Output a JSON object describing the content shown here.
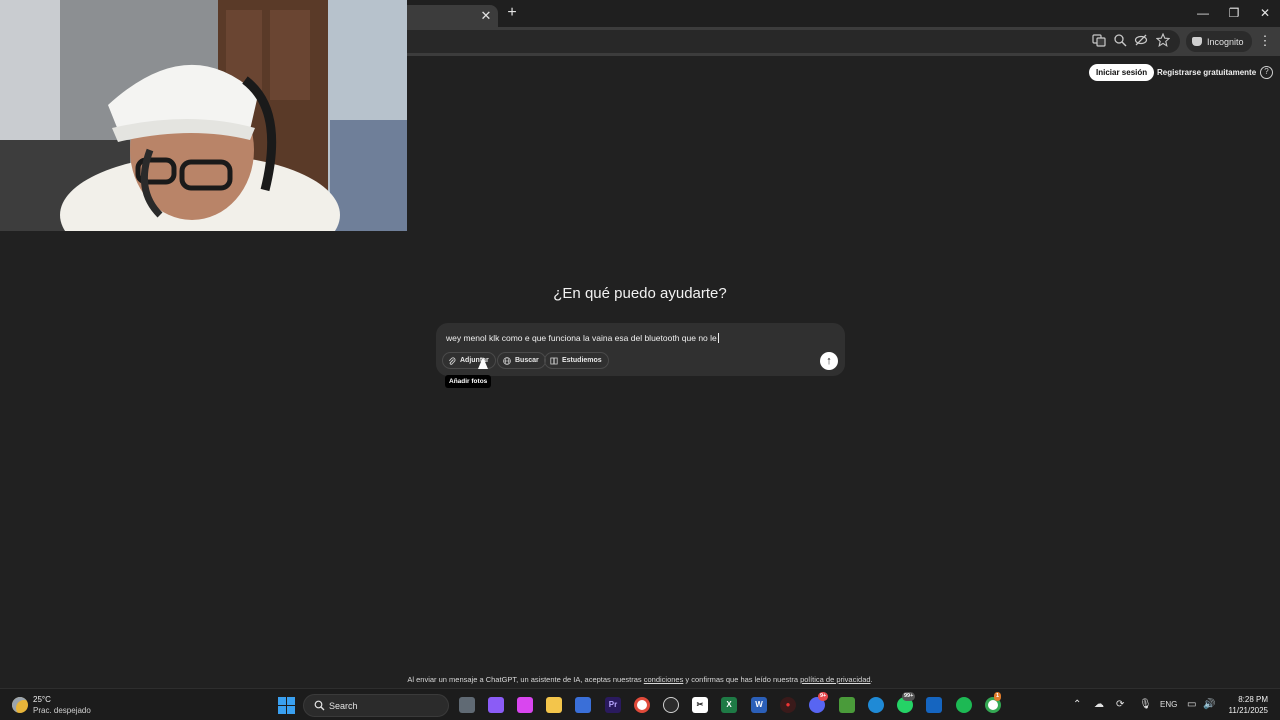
{
  "browser": {
    "tab_close": "✕",
    "new_tab": "+",
    "incognito_label": "Incognito",
    "window_controls": {
      "minimize": "—",
      "restore": "❐",
      "close": "✕"
    }
  },
  "header": {
    "login_label": "Iniciar sesión",
    "signup_label": "Registrarse gratuitamente",
    "help_glyph": "?"
  },
  "main": {
    "headline": "¿En qué puedo ayudarte?",
    "prompt_text": "wey menol klk como e que funciona la vaina esa del bluetooth que no le",
    "chips": [
      {
        "label": "Adjuntar",
        "icon": "paperclip-icon"
      },
      {
        "label": "Buscar",
        "icon": "globe-icon"
      },
      {
        "label": "Estudiemos",
        "icon": "book-icon"
      }
    ],
    "tooltip": "Añadir fotos",
    "send_glyph": "↑"
  },
  "footer": {
    "disclaimer_pre": "Al enviar un mensaje a ChatGPT, un asistente de IA, aceptas nuestras ",
    "terms_link": "condiciones",
    "disclaimer_mid": " y confirmas que has leído nuestra ",
    "privacy_link": "política de privacidad",
    "disclaimer_post": "."
  },
  "taskbar": {
    "weather_temp": "25°C",
    "weather_desc": "Prac. despejado",
    "search_label": "Search",
    "badges": {
      "discord": "9+",
      "whatsapp": "99+",
      "chrome": "1"
    },
    "language": "ENG",
    "time": "8:28 PM",
    "date": "11/21/2025"
  },
  "colors": {
    "page_bg": "#212121",
    "composer_bg": "#303030",
    "taskbar_bg": "#1c1c1c",
    "accent_windows": "#3aa0f0"
  }
}
